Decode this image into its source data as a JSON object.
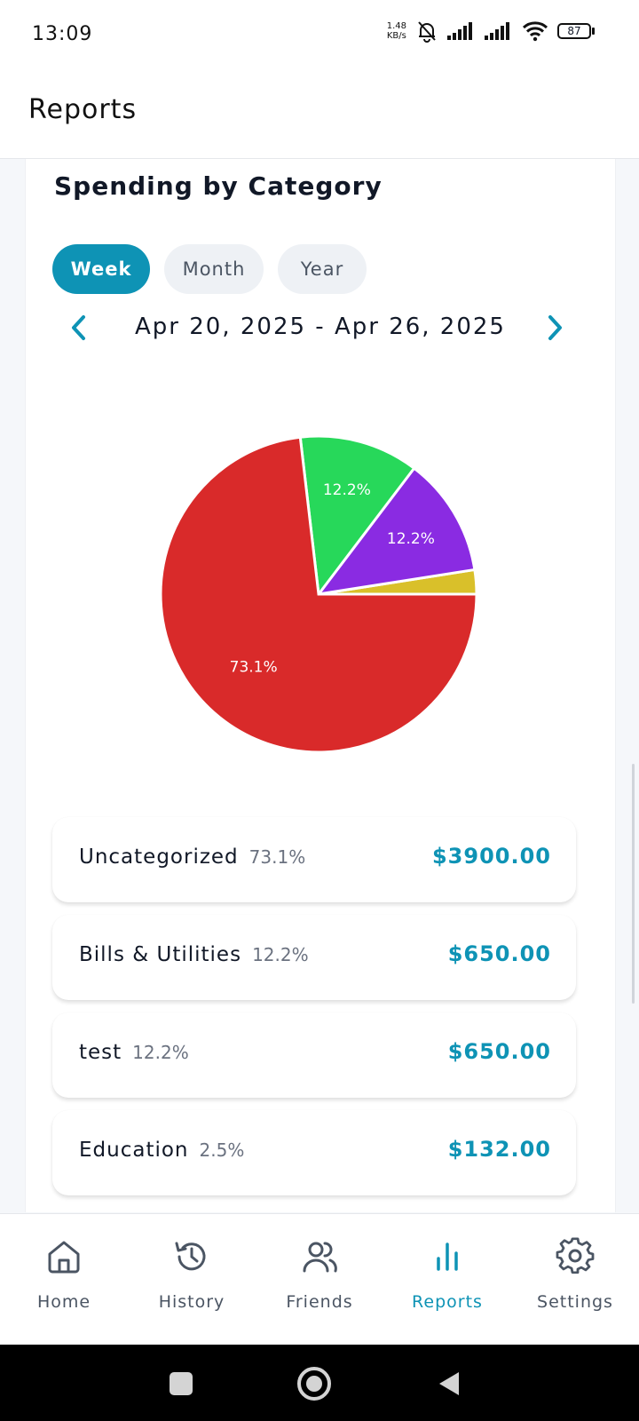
{
  "status": {
    "time": "13:09",
    "speed_value": "1.48",
    "speed_unit": "KB/s",
    "battery": "87",
    "icons": [
      "mute-bell-icon",
      "signal-icon",
      "signal-icon",
      "wifi-icon",
      "battery-icon"
    ]
  },
  "header": {
    "title": "Reports"
  },
  "section": {
    "title": "Spending by Category"
  },
  "period_tabs": {
    "week": "Week",
    "month": "Month",
    "year": "Year",
    "selected": "Week"
  },
  "date_nav": {
    "range": "Apr 20, 2025 - Apr 26, 2025"
  },
  "chart_data": {
    "type": "pie",
    "series": [
      {
        "name": "Uncategorized",
        "value": 3900,
        "percent": 73.1,
        "label": "73.1%",
        "color": "#d92a2a"
      },
      {
        "name": "Bills & Utilities",
        "value": 650,
        "percent": 12.2,
        "label": "12.2%",
        "color": "#27d85a"
      },
      {
        "name": "test",
        "value": 650,
        "percent": 12.2,
        "label": "12.2%",
        "color": "#8a2be2"
      },
      {
        "name": "Education",
        "value": 132,
        "percent": 2.5,
        "label": "",
        "color": "#d9c02a"
      }
    ]
  },
  "categories": [
    {
      "name": "Uncategorized",
      "percent": "73.1%",
      "amount": "$3900.00"
    },
    {
      "name": "Bills & Utilities",
      "percent": "12.2%",
      "amount": "$650.00"
    },
    {
      "name": "test",
      "percent": "12.2%",
      "amount": "$650.00"
    },
    {
      "name": "Education",
      "percent": "2.5%",
      "amount": "$132.00"
    }
  ],
  "nav": {
    "items": [
      {
        "label": "Home",
        "icon": "home-icon"
      },
      {
        "label": "History",
        "icon": "history-icon"
      },
      {
        "label": "Friends",
        "icon": "friends-icon"
      },
      {
        "label": "Reports",
        "icon": "reports-icon"
      },
      {
        "label": "Settings",
        "icon": "settings-icon"
      }
    ],
    "active": "Reports"
  },
  "colors": {
    "accent": "#0e93b5",
    "text": "#111827",
    "muted": "#6b7280"
  }
}
